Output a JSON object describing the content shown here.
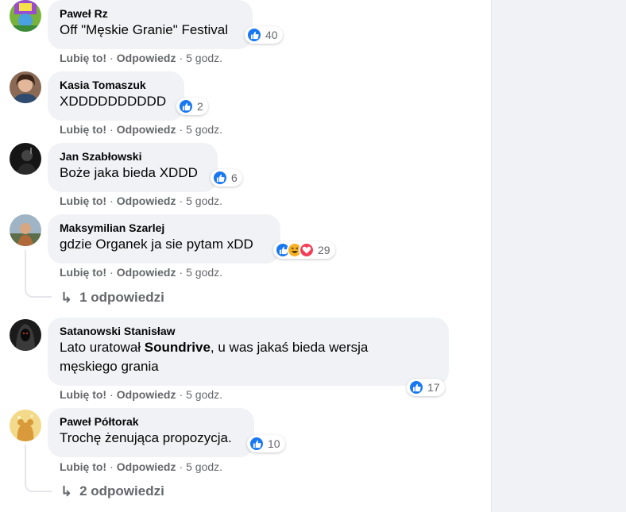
{
  "colors": {
    "bubble": "#f0f2f5",
    "meta": "#65676b",
    "like": "#1877f2",
    "haha": "#f7b125",
    "love": "#f33e58"
  },
  "labels": {
    "like": "Lubię to!",
    "reply": "Odpowiedz",
    "dot": "·"
  },
  "comments": [
    {
      "author": "Paweł Rz",
      "text": "Off \"Męskie Granie\" Festival",
      "reactions": [
        "like"
      ],
      "count": "40",
      "time": "5 godz.",
      "avatar": "avatar-illustration"
    },
    {
      "author": "Kasia Tomaszuk",
      "text": "XDDDDDDDDDD",
      "reactions": [
        "like"
      ],
      "count": "2",
      "time": "5 godz.",
      "avatar": "avatar-photo"
    },
    {
      "author": "Jan Szabłowski",
      "text": "Boże jaka bieda XDDD",
      "reactions": [
        "like"
      ],
      "count": "6",
      "time": "5 godz.",
      "avatar": "avatar-photo"
    },
    {
      "author": "Maksymilian Szarlej",
      "text": "gdzie Organek ja sie pytam xDD",
      "reactions": [
        "like",
        "haha",
        "love"
      ],
      "count": "29",
      "time": "5 godz.",
      "replies": "1 odpowiedzi",
      "avatar": "avatar-photo"
    },
    {
      "author": "Satanowski Stanisław",
      "text_line1_before": "Lato uratował ",
      "text_line1_bold": "Soundrive",
      "text_line1_after": ", u was jakaś bieda wersja",
      "text_line2": "męskiego grania",
      "reactions": [
        "like"
      ],
      "count": "17",
      "time": "5 godz.",
      "avatar": "avatar-photo"
    },
    {
      "author": "Paweł Półtorak",
      "text": "Trochę żenująca propozycja.",
      "reactions": [
        "like"
      ],
      "count": "10",
      "time": "5 godz.",
      "replies": "2 odpowiedzi",
      "avatar": "avatar-illustration"
    }
  ]
}
